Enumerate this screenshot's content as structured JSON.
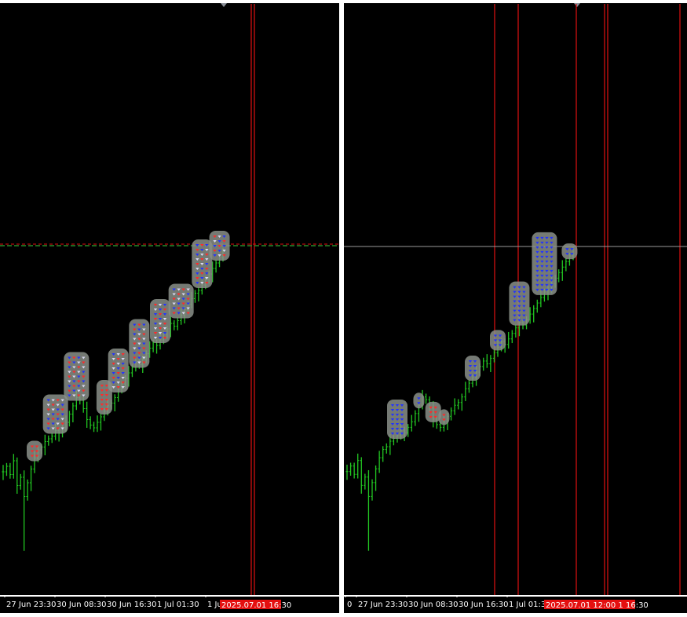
{
  "colors": {
    "background": "#000000",
    "candle": "#22c822",
    "marker_buy": "#2233ff",
    "marker_sell": "#ff2a2a",
    "marker_halo": "#8a8f88",
    "vline": "#e01010",
    "price_line_left": "#2a8a2a",
    "price_line_right": "#9a9a9a",
    "time_flag_bg": "#e41010"
  },
  "chart_data": [
    {
      "type": "candlestick",
      "name_shown": "",
      "x_tick_labels": [
        "27 Jun 23:30",
        "30 Jun 08:30",
        "30 Jun 16:30",
        "1 Jul 01:30",
        "1 Ju"
      ],
      "time_flag": "2025.07.01 16:30",
      "price_line": "dashed",
      "grid": false,
      "y_range_relative": [
        0,
        100
      ],
      "close_series": [
        14,
        16,
        13,
        18,
        9,
        12,
        5,
        10,
        15,
        19,
        22,
        23,
        25,
        26,
        27,
        29,
        28,
        30,
        32,
        35,
        38,
        41,
        40,
        37,
        33,
        31,
        30,
        32,
        34,
        36,
        38,
        39,
        41,
        44,
        46,
        48,
        50,
        52,
        54,
        53,
        55,
        57,
        59,
        61,
        60,
        62,
        64,
        66,
        68,
        67,
        69,
        71,
        73,
        75,
        77,
        79,
        80,
        82,
        84,
        86,
        88,
        90,
        92,
        93
      ],
      "vertical_lines": 2
    },
    {
      "type": "candlestick",
      "name_shown": "",
      "x_tick_labels": [
        "0",
        "27 Jun 23:30",
        "30 Jun 08:30",
        "30 Jun 16:30",
        "1 Jul 01:30"
      ],
      "time_flag": "2025.07.01 12:00  1 16:30",
      "price_line": "solid",
      "grid": false,
      "y_range_relative": [
        0,
        100
      ],
      "close_series": [
        14,
        16,
        13,
        18,
        9,
        12,
        5,
        10,
        15,
        19,
        22,
        23,
        25,
        26,
        27,
        29,
        28,
        30,
        32,
        35,
        38,
        41,
        40,
        37,
        33,
        31,
        30,
        32,
        34,
        36,
        38,
        39,
        41,
        44,
        46,
        48,
        50,
        52,
        54,
        53,
        55,
        57,
        59,
        61,
        60,
        62,
        64,
        66,
        68,
        67,
        69,
        71,
        73,
        75,
        77,
        79,
        80,
        82,
        84,
        86,
        88,
        90,
        92,
        93
      ],
      "vertical_lines": 6
    }
  ]
}
